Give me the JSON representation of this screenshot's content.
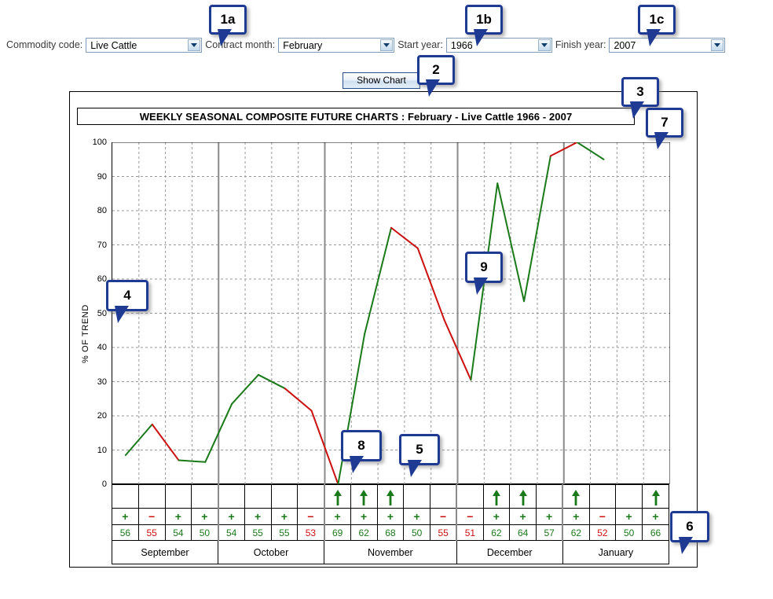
{
  "form": {
    "commodity_label": "Commodity code:",
    "commodity_value": "Live Cattle",
    "contract_label": "Contract month:",
    "contract_value": "February",
    "start_label": "Start year:",
    "start_value": "1966",
    "finish_label": "Finish year:",
    "finish_value": "2007",
    "show_chart_label": "Show Chart"
  },
  "chart_data": {
    "type": "line",
    "title": "WEEKLY SEASONAL COMPOSITE FUTURE CHARTS : February - Live Cattle 1966 - 2007",
    "ylabel": "% OF TREND",
    "xlabel": "",
    "ylim": [
      0,
      100
    ],
    "yticks": [
      100,
      90,
      80,
      70,
      60,
      50,
      40,
      30,
      20,
      10,
      0
    ],
    "grid": true,
    "legend": "none",
    "months": [
      {
        "name": "September",
        "weeks": 4
      },
      {
        "name": "October",
        "weeks": 4
      },
      {
        "name": "November",
        "weeks": 5
      },
      {
        "name": "December",
        "weeks": 4
      },
      {
        "name": "January",
        "weeks": 4
      }
    ],
    "values": [
      8.5,
      17.5,
      7,
      6.5,
      23.5,
      32,
      28,
      21.5,
      0,
      44,
      75,
      69,
      48,
      30.5,
      88,
      53.5,
      96,
      100,
      95
    ],
    "segment_colors": [
      "green",
      "red",
      "green",
      "green",
      "green",
      "green",
      "red",
      "red",
      "green",
      "green",
      "red",
      "red",
      "red",
      "green",
      "green",
      "green",
      "red",
      "green"
    ],
    "signs": [
      "+",
      "−",
      "+",
      "+",
      "+",
      "+",
      "+",
      "−",
      "+",
      "+",
      "+",
      "+",
      "−",
      "−",
      "+",
      "+",
      "+",
      "+",
      "−",
      "+",
      "+"
    ],
    "percents": [
      "56",
      "55",
      "54",
      "50",
      "54",
      "55",
      "55",
      "53",
      "69",
      "62",
      "68",
      "50",
      "55",
      "51",
      "62",
      "64",
      "57",
      "62",
      "52",
      "50",
      "66"
    ],
    "arrows": [
      false,
      false,
      false,
      false,
      false,
      false,
      false,
      false,
      true,
      true,
      true,
      false,
      false,
      false,
      true,
      true,
      false,
      true,
      false,
      false,
      true
    ]
  },
  "callouts": [
    {
      "id": "1a",
      "label": "1a"
    },
    {
      "id": "1b",
      "label": "1b"
    },
    {
      "id": "1c",
      "label": "1c"
    },
    {
      "id": "2",
      "label": "2"
    },
    {
      "id": "3",
      "label": "3"
    },
    {
      "id": "4",
      "label": "4"
    },
    {
      "id": "5",
      "label": "5"
    },
    {
      "id": "6",
      "label": "6"
    },
    {
      "id": "7",
      "label": "7"
    },
    {
      "id": "8",
      "label": "8"
    },
    {
      "id": "9",
      "label": "9"
    }
  ],
  "colors": {
    "up": "#1a7a1a",
    "down": "#cc1111",
    "callout_border": "#1f3a93",
    "separator": "#8a8a8a"
  }
}
